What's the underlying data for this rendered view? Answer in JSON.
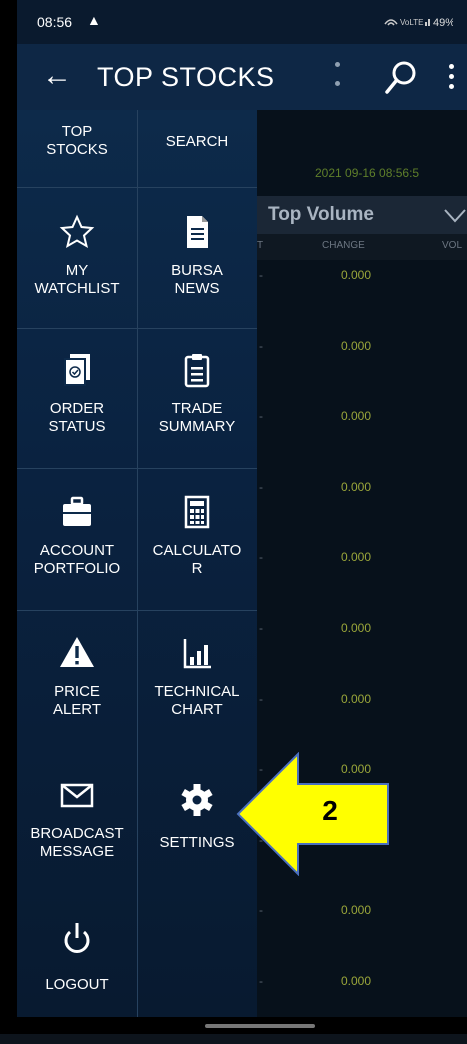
{
  "status_bar": {
    "time": "08:56",
    "warning_icon": "warning-icon",
    "right_text": "≈⋮ .∥ 49%"
  },
  "app_bar": {
    "title": "TOP STOCKS",
    "back_icon": "back-arrow-icon",
    "search_icon": "search-icon",
    "more_icon": "more-vert-icon"
  },
  "background": {
    "timestamp": "2021 09-16 08:56:5",
    "sort_label": "Top Volume",
    "headers": {
      "col1": "T",
      "col2": "CHANGE",
      "col3": "VOL"
    },
    "rows": [
      {
        "dash": "-",
        "change": "0.000"
      },
      {
        "dash": "-",
        "change": "0.000"
      },
      {
        "dash": "-",
        "change": "0.000"
      },
      {
        "dash": "-",
        "change": "0.000"
      },
      {
        "dash": "-",
        "change": "0.000"
      },
      {
        "dash": "-",
        "change": "0.000"
      },
      {
        "dash": "-",
        "change": "0.000"
      },
      {
        "dash": "-",
        "change": "0.000"
      },
      {
        "dash": "-",
        "change": "0.000"
      },
      {
        "dash": "-",
        "change": "0.000"
      },
      {
        "dash": "-",
        "change": "0.000"
      },
      {
        "dash": "-",
        "change": "0.000"
      }
    ]
  },
  "drawer": {
    "items": [
      {
        "label_line1": "TOP",
        "label_line2": "STOCKS",
        "icon": "top-stocks-icon"
      },
      {
        "label_line1": "SEARCH",
        "label_line2": "",
        "icon": "search-icon"
      },
      {
        "label_line1": "MY",
        "label_line2": "WATCHLIST",
        "icon": "star-icon"
      },
      {
        "label_line1": "BURSA",
        "label_line2": "NEWS",
        "icon": "document-icon"
      },
      {
        "label_line1": "ORDER",
        "label_line2": "STATUS",
        "icon": "order-status-icon"
      },
      {
        "label_line1": "TRADE",
        "label_line2": "SUMMARY",
        "icon": "clipboard-icon"
      },
      {
        "label_line1": "ACCOUNT",
        "label_line2": "PORTFOLIO",
        "icon": "briefcase-icon"
      },
      {
        "label_line1": "CALCULATO",
        "label_line2": "R",
        "icon": "calculator-icon"
      },
      {
        "label_line1": "PRICE",
        "label_line2": "ALERT",
        "icon": "alert-triangle-icon"
      },
      {
        "label_line1": "TECHNICAL",
        "label_line2": "CHART",
        "icon": "bar-chart-icon"
      },
      {
        "label_line1": "BROADCAST",
        "label_line2": "MESSAGE",
        "icon": "envelope-icon"
      },
      {
        "label_line1": "SETTINGS",
        "label_line2": "",
        "icon": "gear-icon"
      },
      {
        "label_line1": "LOGOUT",
        "label_line2": "",
        "icon": "power-icon"
      }
    ]
  },
  "annotation": {
    "number": "2",
    "arrow_color": "#ffff00"
  },
  "colors": {
    "drawer": "#0d2a4a",
    "app_bar": "#0e2745",
    "value_green": "#9aa63a"
  }
}
